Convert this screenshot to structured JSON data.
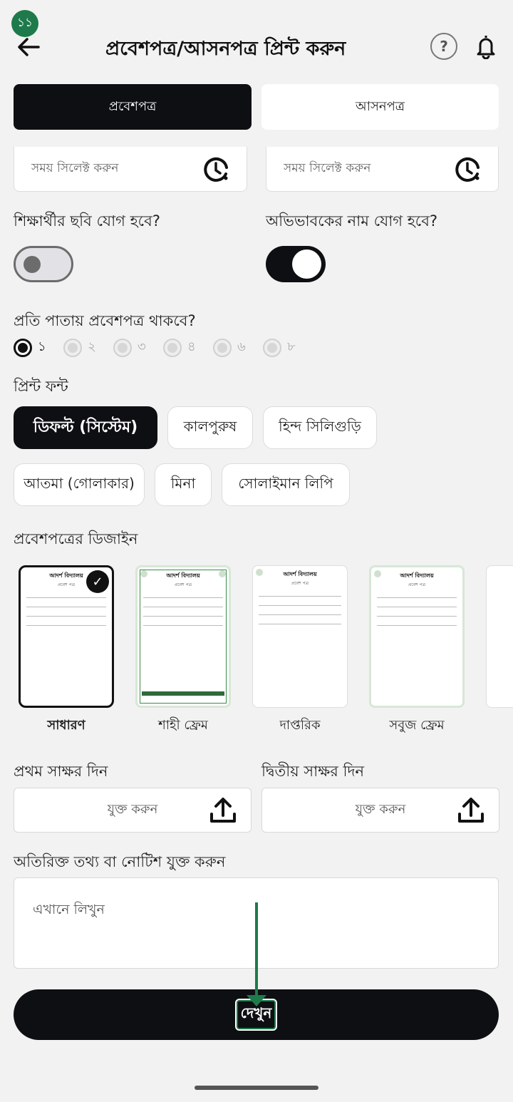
{
  "step_badge": "১১",
  "header": {
    "title": "প্রবেশপত্র/আসনপত্র প্রিন্ট করুন",
    "help_symbol": "?"
  },
  "tabs": [
    {
      "label": "প্রবেশপত্র",
      "active": true
    },
    {
      "label": "আসনপত্র",
      "active": false
    }
  ],
  "time_fields": [
    {
      "placeholder": "সময় সিলেক্ট করুন"
    },
    {
      "placeholder": "সময় সিলেক্ট করুন"
    }
  ],
  "toggles": [
    {
      "label": "শিক্ষার্থীর ছবি যোগ হবে?",
      "on": false
    },
    {
      "label": "অভিভাবকের নাম যোগ হবে?",
      "on": true
    }
  ],
  "per_page": {
    "label": "প্রতি পাতায় প্রবেশপত্র থাকবে?",
    "options": [
      "১",
      "২",
      "৩",
      "৪",
      "৬",
      "৮"
    ],
    "selected": "১"
  },
  "font": {
    "label": "প্রিন্ট ফন্ট",
    "options": [
      "ডিফল্ট (সিস্টেম)",
      "কালপুরুষ",
      "হিন্দ সিলিগুড়ি",
      "আতমা (গোলাকার)",
      "মিনা",
      "সোলাইমান লিপি"
    ],
    "selected": "ডিফল্ট (সিস্টেম)"
  },
  "design": {
    "label": "প্রবেশপত্রের ডিজাইন",
    "options": [
      "সাধারণ",
      "শাহী ফ্রেম",
      "দাপ্তরিক",
      "সবুজ ফ্রেম"
    ],
    "selected": "সাধারণ",
    "preview_title": "আদর্শ বিদ্যালয়",
    "preview_sub": "প্রবেশ পত্র"
  },
  "signatures": {
    "first_label": "প্রথম সাক্ষর দিন",
    "second_label": "দ্বিতীয় সাক্ষর দিন",
    "button": "যুক্ত করুন"
  },
  "notes": {
    "label": "অতিরিক্ত তথ্য বা নোটিশ যুক্ত করুন",
    "placeholder": "এখানে লিখুন"
  },
  "view_button": "দেখুন",
  "colors": {
    "accent": "#1e7a4a",
    "dark": "#0e0f13"
  }
}
